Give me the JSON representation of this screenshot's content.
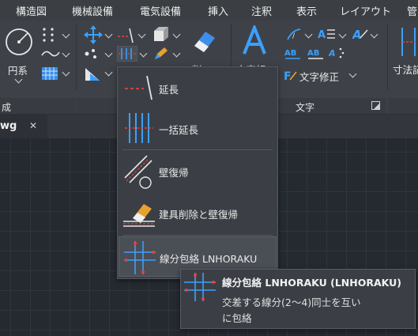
{
  "menu_tabs": [
    "構造図",
    "機械設備",
    "電気設備",
    "挿入",
    "注釈",
    "表示",
    "レイアウト",
    "管"
  ],
  "ribbon": {
    "left_group_label": "円系",
    "left_footer_label": "成",
    "erase_label": "削",
    "text_group": {
      "big_label_partial": "文字記",
      "text_edit_label": "文字修正",
      "footer_label": "文字"
    },
    "dim_label": "寸法記"
  },
  "document_tab": {
    "name": "wg",
    "close": "✕"
  },
  "dropdown": {
    "items": [
      {
        "label": "延長"
      },
      {
        "label": "一括延長"
      },
      {
        "label": "壁復帰"
      },
      {
        "label": "建具削除と壁復帰"
      },
      {
        "label": "線分包絡 LNHORAKU",
        "highlighted": true
      }
    ]
  },
  "tooltip": {
    "title": "線分包絡 LNHORAKU (LNHORAKU)",
    "line1": "交差する線分(2～4)同士を互い",
    "line2": "に包絡"
  },
  "colors": {
    "accent_blue": "#3aa0ff",
    "red_marker": "#e34040",
    "eraser_blue": "#3f8ee8"
  }
}
